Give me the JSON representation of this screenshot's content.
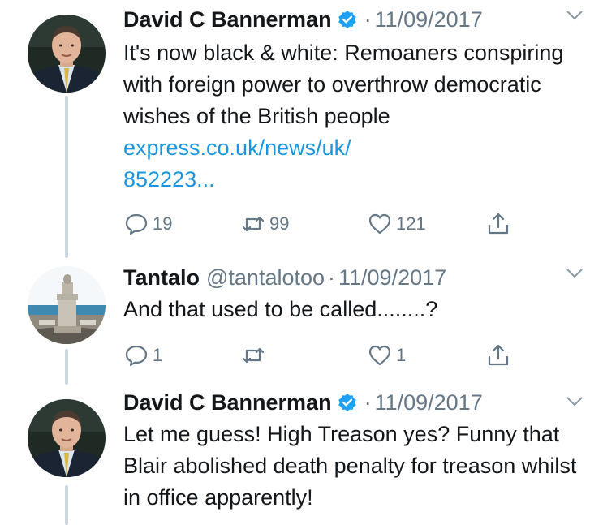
{
  "tweets": [
    {
      "name": "David C Bannerman",
      "handle": "",
      "date": "11/09/2017",
      "text": "It's now black & white: Remoaners conspiring with foreign power to overthrow democratic wishes of the British people ",
      "link_line1": "express.co.uk/news/uk/",
      "link_line2": "852223...",
      "replies": "19",
      "retweets": "99",
      "likes": "121",
      "verified": true,
      "avatar": "man-in-suit-avatar"
    },
    {
      "name": "Tantalo",
      "handle": "@tantalotoo",
      "date": "11/09/2017",
      "text": "And that used to be called........?",
      "replies": "1",
      "retweets": "",
      "likes": "1",
      "verified": false,
      "avatar": "monument-avatar"
    },
    {
      "name": "David C Bannerman",
      "handle": "",
      "date": "11/09/2017",
      "text": "Let me guess! High Treason yes? Funny that Blair abolished death penalty for treason whilst in office apparently!",
      "verified": true,
      "avatar": "man-in-suit-avatar"
    }
  ],
  "colors": {
    "link": "#1b95e0",
    "meta": "#657786",
    "thread_line": "#ccd6dd",
    "verified": "#1da1f2"
  }
}
